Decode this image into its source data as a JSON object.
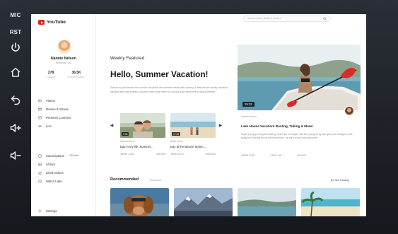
{
  "bezel": {
    "buttons": [
      {
        "label": "MIC",
        "icon": "mic-label"
      },
      {
        "label": "RST",
        "icon": "reset-label"
      },
      {
        "label": "",
        "icon": "power-icon"
      },
      {
        "label": "",
        "icon": "home-icon"
      },
      {
        "label": "",
        "icon": "back-icon"
      },
      {
        "label": "",
        "icon": "volume-up-icon"
      },
      {
        "label": "",
        "icon": "volume-down-icon"
      }
    ]
  },
  "app": {
    "name": "YouTube",
    "brand_color": "#e62117"
  },
  "search": {
    "placeholder": "Search videos, artists or authors..."
  },
  "profile": {
    "name": "Nannie Nelson",
    "location": "Montreal, QC",
    "videos_count": "278",
    "videos_label": "VIDEOS",
    "subscribers_count": "36.5K",
    "subscribers_label": "SUBSCRIBERS"
  },
  "nav_top": [
    {
      "label": "Videos",
      "icon": "video-icon"
    },
    {
      "label": "Movies & Shows",
      "icon": "movie-icon"
    },
    {
      "label": "Premium Contents",
      "icon": "premium-icon"
    },
    {
      "label": "Live",
      "icon": "live-icon"
    }
  ],
  "nav_bottom": [
    {
      "label": "Subscriptions",
      "icon": "subscriptions-icon",
      "badge": "29 new"
    },
    {
      "label": "Library",
      "icon": "library-icon"
    },
    {
      "label": "Liked Videos",
      "icon": "like-icon"
    },
    {
      "label": "Watch Later",
      "icon": "clock-icon"
    }
  ],
  "nav_settings": {
    "label": "Settings",
    "icon": "gear-icon"
  },
  "featured": {
    "section_title": "Weekly Featured",
    "headline": "Hello, Summer Vacation!",
    "description": "School is just around the corner, we finish off summer break with a bang. A last minute family vacation will give the kids stories to share when they return to school and memories to last a lifetime."
  },
  "carousel": [
    {
      "duration": "9:48",
      "channel": "Michael Acorn",
      "title": "Day in my life: Summer...",
      "views": "VIEWS 12.8K",
      "likes": "30K ADS"
    },
    {
      "duration": "17:02",
      "channel": "Bellie Cross",
      "title": "Day at the Beach! Summ...",
      "views": "VIEWS 28.7K",
      "likes": "160K ADS"
    }
  ],
  "hero": {
    "duration": "29:32",
    "channel": "Warren Munoz",
    "title": "Lake House Vacation! Boating, Tubing & More!",
    "description": "Hope you guys enjoyed boating, which we no longer had time going to try and get more footage of the really fun stuff we do up north next time, be sure to like and subscribe!",
    "views": "VIEWS 32.5K",
    "likes": "LIKES 1.4K",
    "ads": "305 ADS"
  },
  "recommended": {
    "title": "Recommended",
    "show_more": "Show More",
    "trending": "By View Trending"
  }
}
